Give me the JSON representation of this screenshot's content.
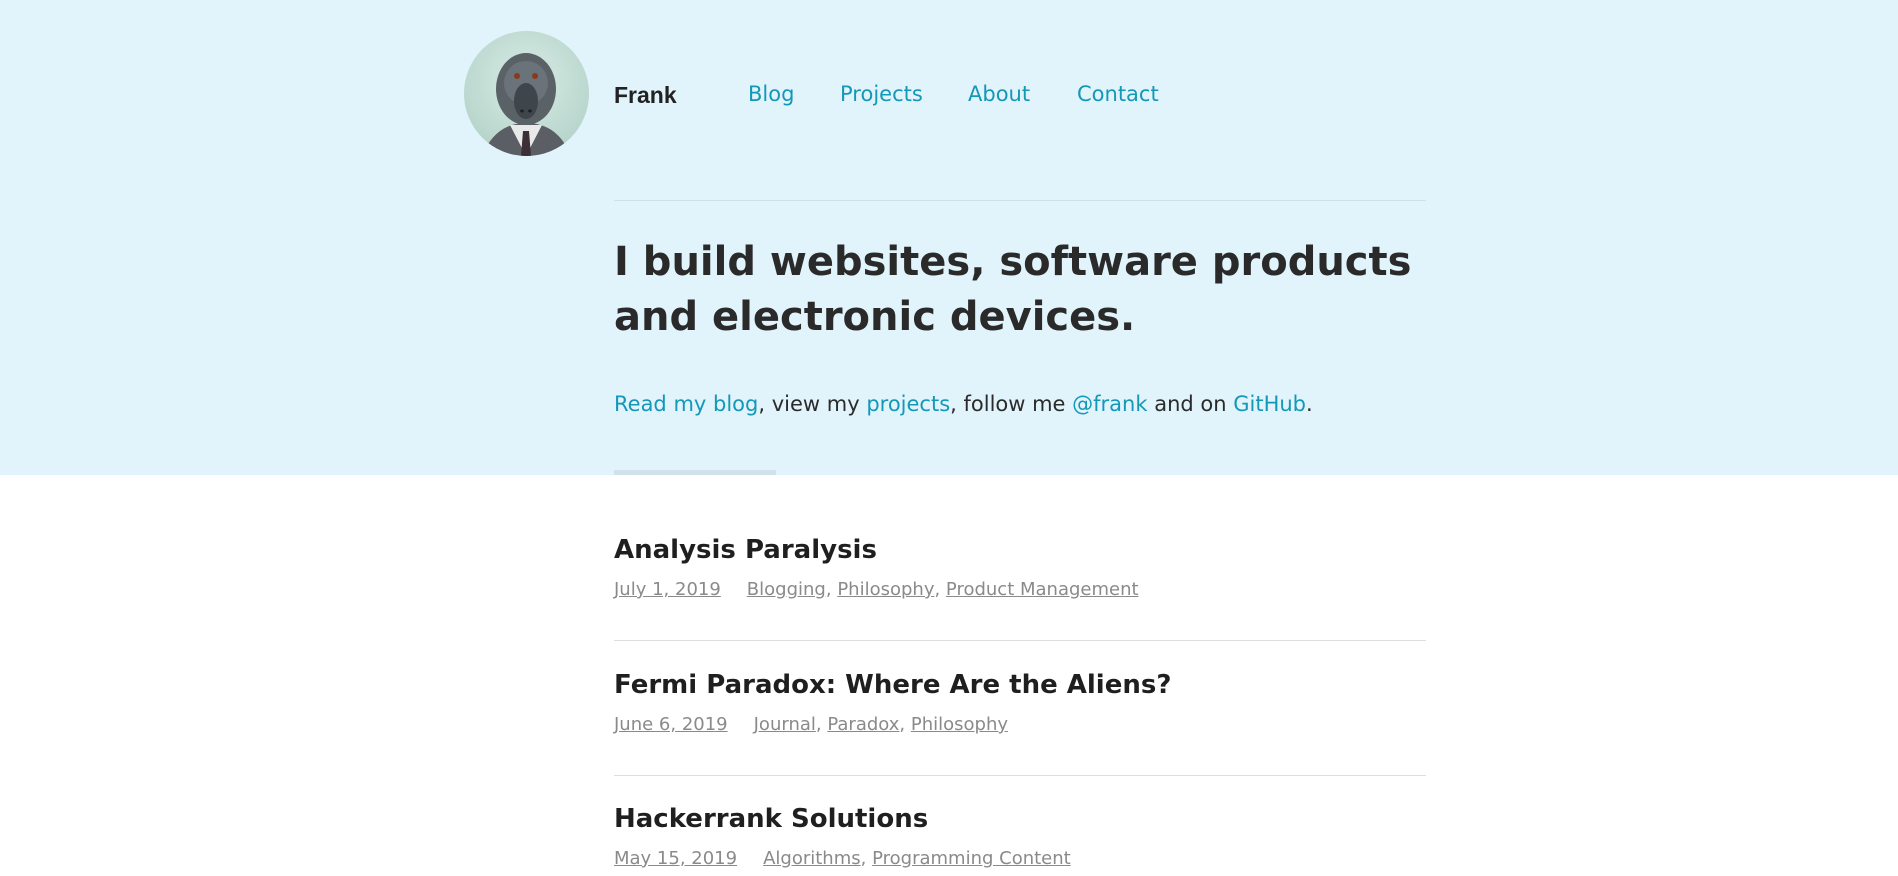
{
  "site": {
    "name": "Frank",
    "avatar_icon": "baboon-avatar-icon"
  },
  "nav": [
    {
      "label": "Blog"
    },
    {
      "label": "Projects"
    },
    {
      "label": "About"
    },
    {
      "label": "Contact"
    }
  ],
  "hero": {
    "headline": "I build websites, software products and electronic devices.",
    "social": {
      "blog_link": "Read my blog",
      "text1": ", view my ",
      "projects_link": "projects",
      "text2": ", follow me ",
      "handle_link": "@frank",
      "text3": " and on ",
      "github_link": "GitHub",
      "text4": "."
    }
  },
  "posts": [
    {
      "title": "Analysis Paralysis",
      "date": "July 1, 2019",
      "tags": [
        "Blogging",
        "Philosophy",
        "Product Management"
      ]
    },
    {
      "title": "Fermi Paradox: Where Are the Aliens?",
      "date": "June 6, 2019",
      "tags": [
        "Journal",
        "Paradox",
        "Philosophy"
      ]
    },
    {
      "title": "Hackerrank Solutions",
      "date": "May 15, 2019",
      "tags": [
        "Algorithms",
        "Programming Content"
      ]
    }
  ],
  "colors": {
    "hero_bg": "#e1f3fb",
    "link": "#1498b8",
    "meta": "#8a8a8a"
  }
}
